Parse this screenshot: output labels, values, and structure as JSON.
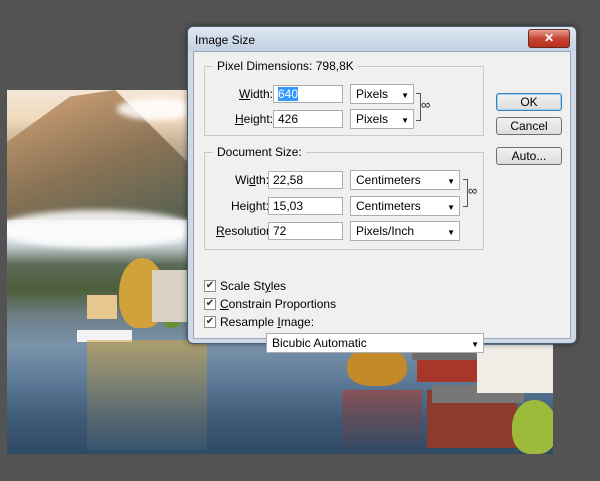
{
  "dialog": {
    "title": "Image Size",
    "close_label": "✕"
  },
  "pixel_dimensions": {
    "legend": "Pixel Dimensions:",
    "size": "798,8K",
    "width_label_u": "W",
    "width_label_rest": "idth:",
    "width_value": "640",
    "width_unit": "Pixels",
    "height_label_u": "H",
    "height_label_rest": "eight:",
    "height_value": "426",
    "height_unit": "Pixels"
  },
  "document_size": {
    "legend": "Document Size:",
    "width_label_pre": "Wi",
    "width_label_u": "d",
    "width_label_rest": "th:",
    "width_value": "22,58",
    "width_unit": "Centimeters",
    "height_label_pre": "Hei",
    "height_label_u": "g",
    "height_label_rest": "ht:",
    "height_value": "15,03",
    "height_unit": "Centimeters",
    "resolution_label_u": "R",
    "resolution_label_rest": "esolution:",
    "resolution_value": "72",
    "resolution_unit": "Pixels/Inch"
  },
  "options": {
    "scale_styles_pre": "Scale St",
    "scale_styles_u": "y",
    "scale_styles_rest": "les",
    "scale_styles_checked": true,
    "constrain_pre": "",
    "constrain_u": "C",
    "constrain_rest": "onstrain Proportions",
    "constrain_checked": true,
    "resample_pre": "Resample ",
    "resample_u": "I",
    "resample_rest": "mage:",
    "resample_checked": true,
    "resample_method": "Bicubic Automatic"
  },
  "buttons": {
    "ok": "OK",
    "cancel": "Cancel",
    "auto": "Auto..."
  },
  "icons": {
    "link": "chain-link-icon",
    "check": "✔",
    "dropdown": "▼"
  }
}
